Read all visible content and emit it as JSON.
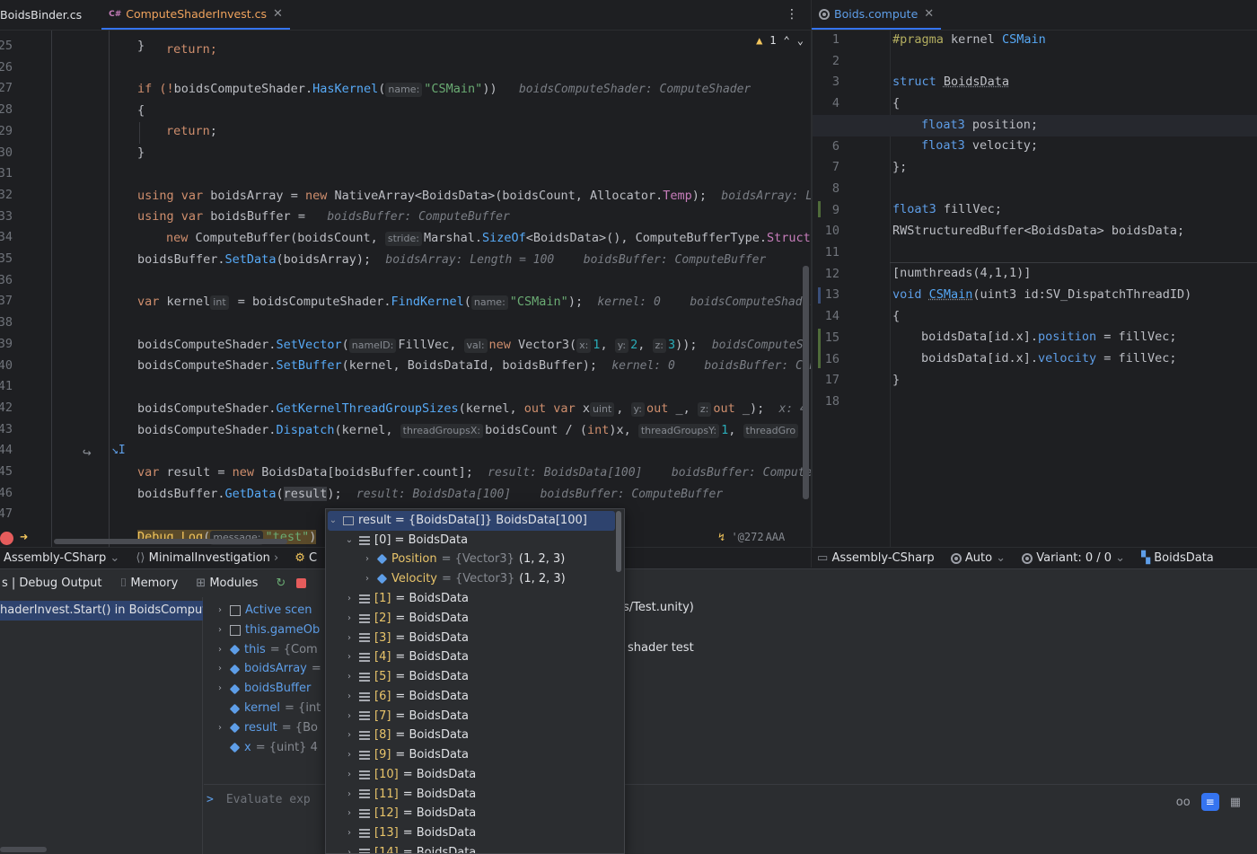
{
  "tabs_left": [
    {
      "label": "BoidsBinder.cs",
      "active": false
    },
    {
      "label": "ComputeShaderInvest.cs",
      "active": true
    }
  ],
  "tabs_right": [
    {
      "label": "Boids.compute",
      "active": true
    }
  ],
  "warning_count": "1",
  "left_line_numbers": [
    "25",
    "26",
    "27",
    "28",
    "29",
    "30",
    "31",
    "32",
    "33",
    "34",
    "35",
    "36",
    "37",
    "38",
    "39",
    "40",
    "41",
    "42",
    "43",
    "44",
    "45",
    "46",
    "47"
  ],
  "left_top_fragment": "return;",
  "left_code": {
    "l25": "}",
    "l27_a": "if (!",
    "l27_b": "boidsComputeShader.",
    "l27_c": "HasKernel",
    "l27_pn": "name:",
    "l27_str": "\"CSMain\"",
    "l27_end": "))",
    "l27_hint": "boidsComputeShader: ComputeShader",
    "l28": "{",
    "l29": "return",
    "l29_end": ";",
    "l30": "}",
    "l32_kw": "using var",
    "l32_a": " boidsArray = ",
    "l32_new": "new",
    "l32_ty": " NativeArray",
    "l32_b": "<BoidsData>(boidsCount, Allocator.",
    "l32_c": "Temp",
    "l32_d": ");",
    "l32_hint": "boidsArray: Le",
    "l33_kw": "using var",
    "l33_a": " boidsBuffer =",
    "l33_hint": "boidsBuffer: ComputeBuffer",
    "l34_new": "new",
    "l34_a": " ComputeBuffer(boidsCount, ",
    "l34_pn": "stride:",
    "l34_b": "Marshal.",
    "l34_c": "SizeOf",
    "l34_d": "<BoidsData>(), ComputeBufferType.",
    "l34_e": "Structur",
    "l35_a": "boidsBuffer.",
    "l35_b": "SetData",
    "l35_c": "(boidsArray);",
    "l35_hint1": "boidsArray: Length = 100",
    "l35_hint2": "boidsBuffer: ComputeBuffer",
    "l37_kw": "var",
    "l37_a": " kernel",
    "l37_pn": "int",
    "l37_b": " = boidsComputeShader.",
    "l37_c": "FindKernel",
    "l37_pn2": "name:",
    "l37_str": "\"CSMain\"",
    "l37_d": ");",
    "l37_hint1": "kernel: 0",
    "l37_hint2": "boidsComputeShader",
    "l39_a": "boidsComputeShader.",
    "l39_b": "SetVector",
    "l39_pn": "nameID:",
    "l39_c": "FillVec, ",
    "l39_pn2": "val:",
    "l39_new": "new",
    "l39_d": " Vector3(",
    "l39_x": "x:",
    "l39_n1": "1",
    "l39_y": "y:",
    "l39_n2": "2",
    "l39_z": "z:",
    "l39_n3": "3",
    "l39_e": "));",
    "l39_hint": "boidsComputeS",
    "l40_a": "boidsComputeShader.",
    "l40_b": "SetBuffer",
    "l40_c": "(kernel, BoidsDataId, boidsBuffer);",
    "l40_hint1": "kernel: 0",
    "l40_hint2": "boidsBuffer: Com",
    "l42_a": "boidsComputeShader.",
    "l42_b": "GetKernelThreadGroupSizes",
    "l42_c": "(kernel, ",
    "l42_out": "out var",
    "l42_d": " x",
    "l42_pn": "uint",
    "l42_e": ", ",
    "l42_y": "y:",
    "l42_out2": "out",
    "l42_f": " _, ",
    "l42_z": "z:",
    "l42_out3": "out",
    "l42_g": " _);",
    "l42_hint": "x: 4",
    "l43_a": "boidsComputeShader.",
    "l43_b": "Dispatch",
    "l43_c": "(kernel, ",
    "l43_pn": "threadGroupsX:",
    "l43_d": "boidsCount / (",
    "l43_int": "int",
    "l43_e": ")x, ",
    "l43_pn2": "threadGroupsY:",
    "l43_n": "1",
    "l43_f": ", ",
    "l43_pn3": "threadGro",
    "l45_kw": "var",
    "l45_a": " result = ",
    "l45_new": "new",
    "l45_b": " BoidsData[boidsBuffer.count];",
    "l45_hint1": "result: BoidsData[100]",
    "l45_hint2": "boidsBuffer: Compute",
    "l46_a": "boidsBuffer.",
    "l46_b": "GetData",
    "l46_c": "(",
    "l46_d": "result",
    "l46_e": ");",
    "l46_hint1": "result: BoidsData[100]",
    "l46_hint2": "boidsBuffer: ComputeBuffer",
    "l48_a": "Debug.",
    "l48_b": "Log",
    "l48_c": "(",
    "l48_pn": "message:",
    "l48_str": "\"test\"",
    "l48_d": ")",
    "l48_hint": "'@272",
    "l48_hint2": "AAA"
  },
  "right_line_numbers": [
    "1",
    "2",
    "3",
    "4",
    "5",
    "6",
    "7",
    "8",
    "9",
    "10",
    "11",
    "12",
    "13",
    "14",
    "15",
    "16",
    "17",
    "18"
  ],
  "right_code": {
    "r1_a": "#pragma",
    "r1_b": " kernel ",
    "r1_c": "CSMain",
    "r3_a": "struct ",
    "r3_b": "BoidsData",
    "r4": "{",
    "r5_a": "float3",
    "r5_b": " position;",
    "r6_a": "float3",
    "r6_b": " velocity;",
    "r7": "};",
    "r9_a": "float3",
    "r9_b": " fillVec;",
    "r10_a": "RWStructuredBuffer",
    "r10_b": "<BoidsData> boidsData;",
    "r12": "[numthreads(4,1,1)]",
    "r13_a": "void ",
    "r13_b": "CSMain",
    "r13_c": "(uint3 id:SV_DispatchThreadID)",
    "r14": "{",
    "r15_a": "boidsData[id.x].",
    "r15_b": "position",
    "r15_c": " = fillVec;",
    "r16_a": "boidsData[id.x].",
    "r16_b": "velocity",
    "r16_c": " = fillVec;",
    "r17": "}"
  },
  "nav_left": {
    "project": "Assembly-CSharp",
    "class": "MinimalInvestigation",
    "method_fragment": "C"
  },
  "nav_right": {
    "project": "Assembly-CSharp",
    "mode": "Auto",
    "variant": "Variant: 0 / 0",
    "struct": "BoidsData"
  },
  "debug_toolbar": {
    "output_tab": "s | Debug Output",
    "memory_tab": "Memory",
    "modules_tab": "Modules"
  },
  "frames": {
    "current": "haderInvest.Start() in BoidsCompute"
  },
  "variables": [
    {
      "name": "Active scen",
      "value": "",
      "expandable": true
    },
    {
      "name": "this.gameOb",
      "value": "",
      "expandable": true
    },
    {
      "name": "this",
      "value": "= {Com",
      "expandable": true
    },
    {
      "name": "boidsArray",
      "value": "=",
      "expandable": true
    },
    {
      "name": "boidsBuffer",
      "value": "",
      "expandable": true
    },
    {
      "name": "kernel",
      "value": "= {int",
      "expandable": false
    },
    {
      "name": "result",
      "value": "= {Bo",
      "expandable": true
    },
    {
      "name": "x",
      "value": "= {uint} 4",
      "expandable": false
    }
  ],
  "console": {
    "line1": "s/Test.unity)",
    "line2": "shader test"
  },
  "evaluate_placeholder": "Evaluate exp",
  "evaluate_prompt": ">",
  "popup": {
    "root": "result = {BoidsData[]} BoidsData[100]",
    "item0": "[0] = BoidsData",
    "position_name": "Position",
    "position_type": "= {Vector3}",
    "position_value": "(1, 2, 3)",
    "velocity_name": "Velocity",
    "velocity_type": "= {Vector3}",
    "velocity_value": "(1, 2, 3)",
    "items": [
      {
        "idx": "[1]",
        "label": "= BoidsData"
      },
      {
        "idx": "[2]",
        "label": "= BoidsData"
      },
      {
        "idx": "[3]",
        "label": "= BoidsData"
      },
      {
        "idx": "[4]",
        "label": "= BoidsData"
      },
      {
        "idx": "[5]",
        "label": "= BoidsData"
      },
      {
        "idx": "[6]",
        "label": "= BoidsData"
      },
      {
        "idx": "[7]",
        "label": "= BoidsData"
      },
      {
        "idx": "[8]",
        "label": "= BoidsData"
      },
      {
        "idx": "[9]",
        "label": "= BoidsData"
      },
      {
        "idx": "[10]",
        "label": "= BoidsData"
      },
      {
        "idx": "[11]",
        "label": "= BoidsData"
      },
      {
        "idx": "[12]",
        "label": "= BoidsData"
      },
      {
        "idx": "[13]",
        "label": "= BoidsData"
      },
      {
        "idx": "[14]",
        "label": "= BoidsData"
      }
    ]
  }
}
